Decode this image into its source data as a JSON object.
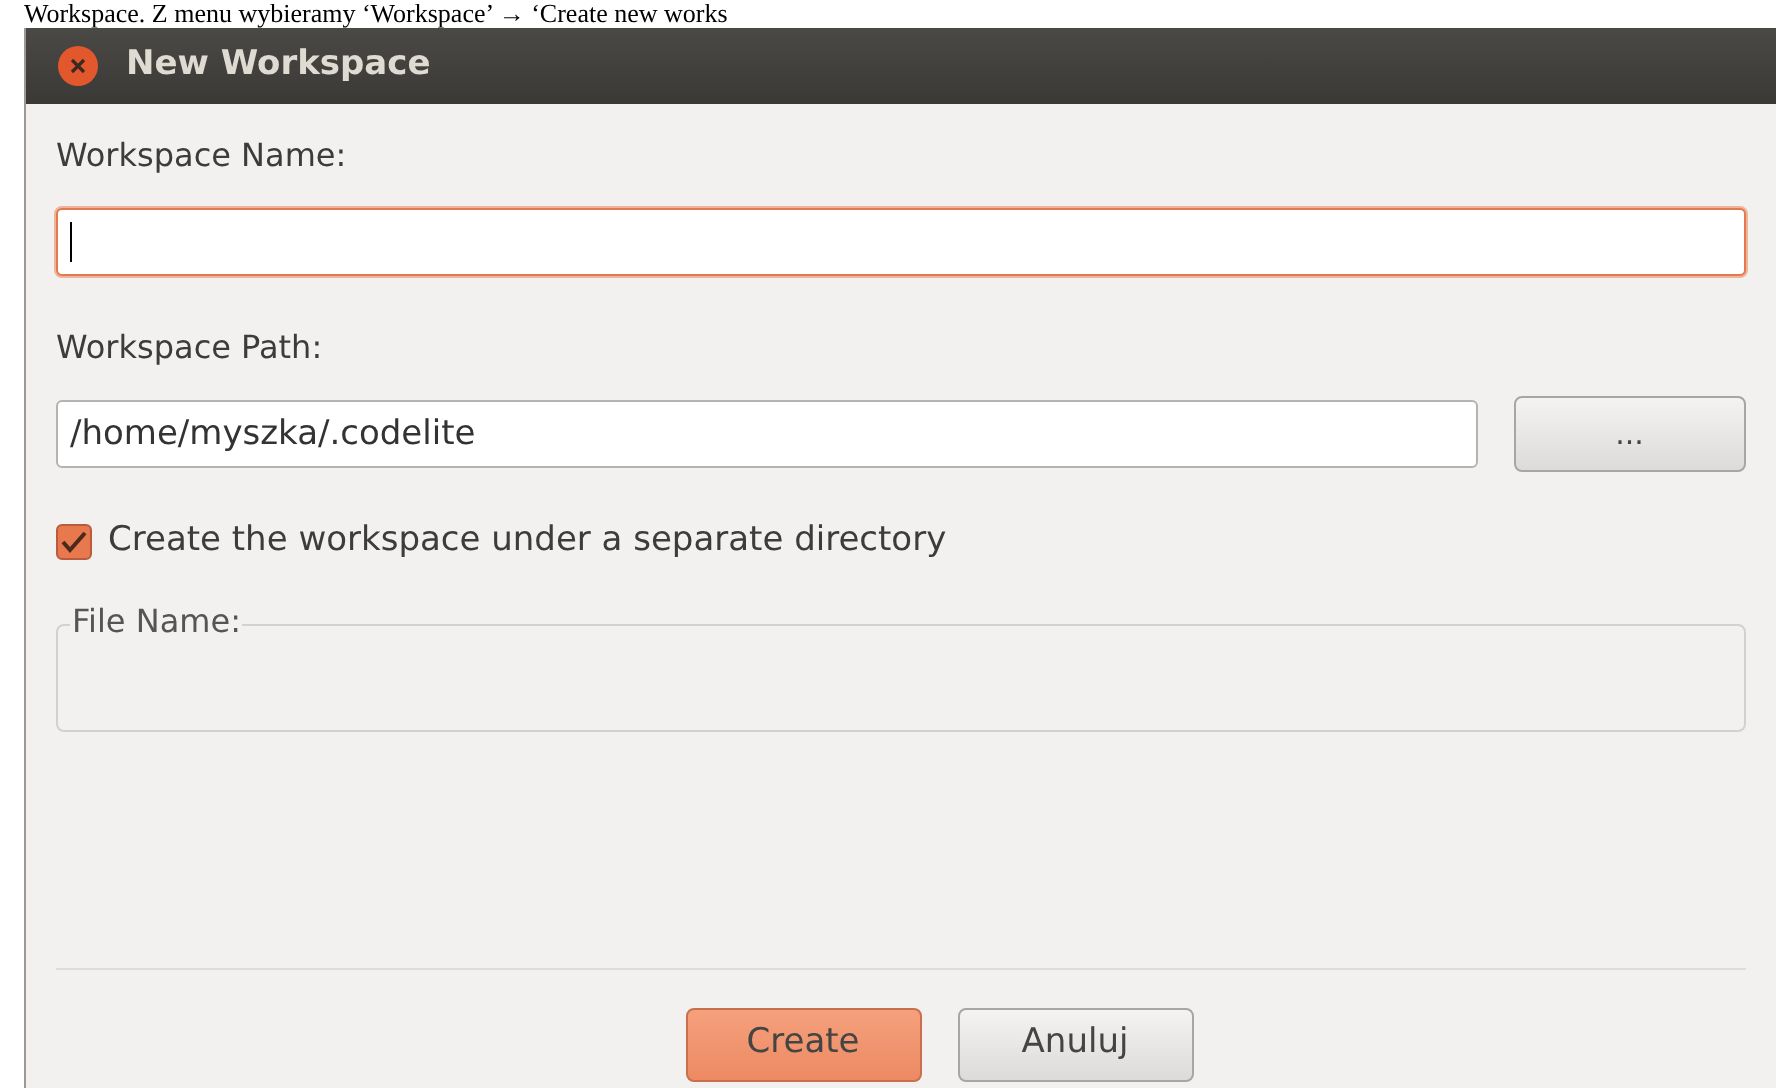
{
  "document_text": "Workspace. Z menu wybieramy ‘Workspace’ → ‘Create new works",
  "window": {
    "title": "New Workspace"
  },
  "name_field": {
    "label": "Workspace Name:",
    "focused": true
  },
  "path_field": {
    "label": "Workspace Path:",
    "value": "/home/myszka/.codelite",
    "browse": "..."
  },
  "separate_dir": {
    "label": "Create the workspace under a separate directory",
    "checked": true
  },
  "file_name": {
    "label": "File Name:"
  },
  "buttons": [
    {
      "label": "Create",
      "kind": "primary"
    },
    {
      "label": "Anuluj",
      "kind": "secondary"
    }
  ]
}
